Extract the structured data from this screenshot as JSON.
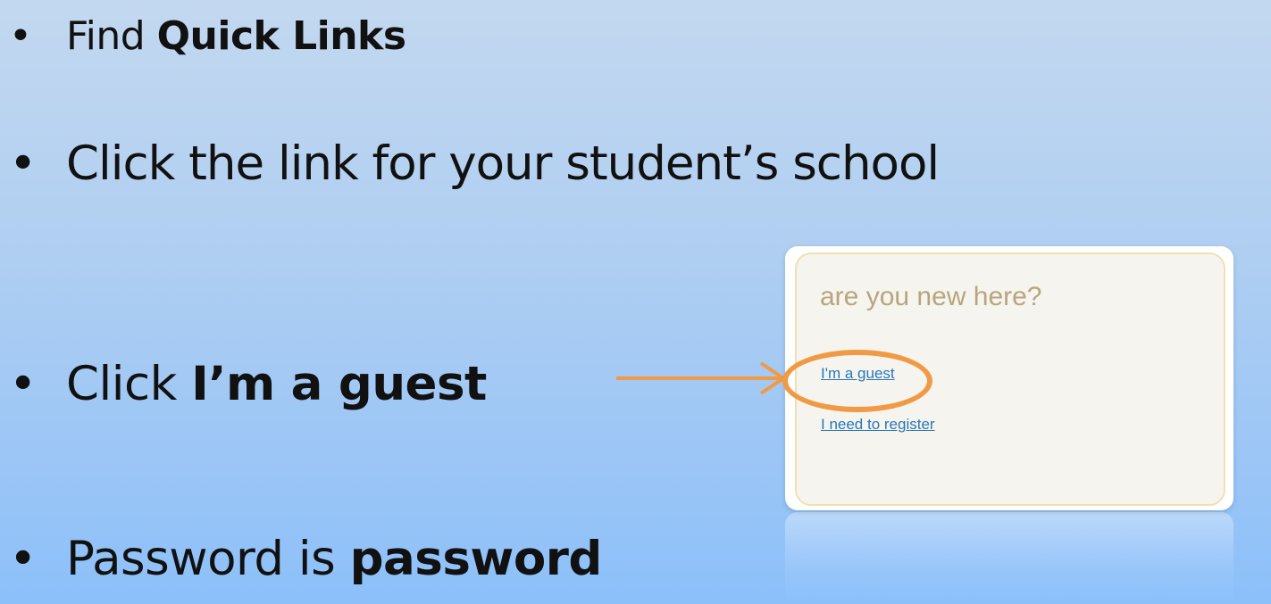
{
  "bullets": [
    {
      "dot": "•",
      "prefix": "Find ",
      "bold": "Quick Links"
    },
    {
      "dot": "•",
      "prefix": "Click the link for your student’s school",
      "bold": ""
    },
    {
      "dot": "•",
      "prefix": "Click ",
      "bold": "I’m a guest"
    },
    {
      "dot": "•",
      "prefix": "Password is ",
      "bold": "password"
    }
  ],
  "card": {
    "title": "are you new here?",
    "guest_link": "I'm a guest",
    "register_link": "I need to register"
  },
  "colors": {
    "highlight": "#f09a45",
    "link": "#2878b8",
    "card_title": "#b7a57f"
  },
  "icons": {
    "arrow": "arrow-right-icon"
  }
}
